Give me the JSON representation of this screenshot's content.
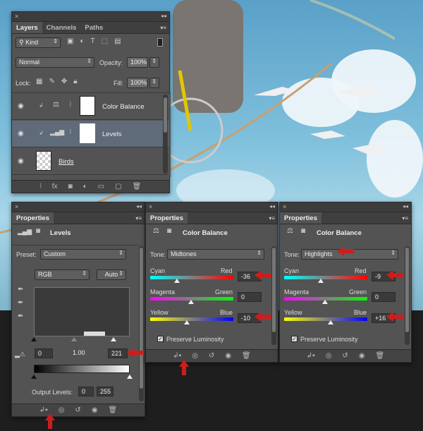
{
  "layers_panel": {
    "tabs": [
      "Layers",
      "Channels",
      "Paths"
    ],
    "kind_label": "Kind",
    "blend_mode": "Normal",
    "opacity_label": "Opacity:",
    "opacity_value": "100%",
    "lock_label": "Lock:",
    "fill_label": "Fill:",
    "fill_value": "100%",
    "layers": [
      {
        "name": "Color Balance"
      },
      {
        "name": "Levels"
      },
      {
        "name": "Birds"
      }
    ]
  },
  "levels_panel": {
    "tab": "Properties",
    "heading": "Levels",
    "preset_label": "Preset:",
    "preset_value": "Custom",
    "channel": "RGB",
    "auto_label": "Auto",
    "input_black": "0",
    "input_gamma": "1.00",
    "input_white": "221",
    "output_label": "Output Levels:",
    "output_black": "0",
    "output_white": "255"
  },
  "cb_mid_panel": {
    "tab": "Properties",
    "heading": "Color Balance",
    "tone_label": "Tone:",
    "tone_value": "Midtones",
    "cyan": "Cyan",
    "red": "Red",
    "cyan_red_value": "-36",
    "magenta": "Magenta",
    "green": "Green",
    "magenta_green_value": "0",
    "yellow": "Yellow",
    "blue": "Blue",
    "yellow_blue_value": "-10",
    "preserve_label": "Preserve Luminosity"
  },
  "cb_high_panel": {
    "tab": "Properties",
    "heading": "Color Balance",
    "tone_label": "Tone:",
    "tone_value": "Highlights",
    "cyan": "Cyan",
    "red": "Red",
    "cyan_red_value": "-9",
    "magenta": "Magenta",
    "green": "Green",
    "magenta_green_value": "0",
    "yellow": "Yellow",
    "blue": "Blue",
    "yellow_blue_value": "+16",
    "preserve_label": "Preserve Luminosity"
  },
  "colors": {
    "highlight_arrow": "#cc1d1d",
    "selected_layer": "#5f6b79",
    "panel_bg": "#535353"
  }
}
